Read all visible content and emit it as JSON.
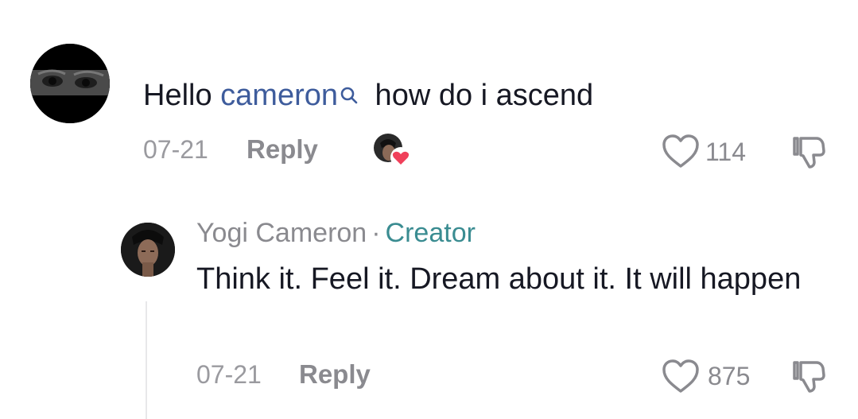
{
  "comment": {
    "prefix": "Hello ",
    "mention": "cameron",
    "suffix": " how do i ascend",
    "date": "07-21",
    "reply_label": "Reply",
    "like_count": "114"
  },
  "reply": {
    "author": "Yogi Cameron",
    "separator": "·",
    "badge": "Creator",
    "text": "Think it. Feel it. Dream about it. It will happen",
    "date": "07-21",
    "reply_label": "Reply",
    "like_count": "875"
  },
  "icons": {
    "search": "search-icon",
    "like": "heart-outline-icon",
    "dislike": "thumbs-down-icon",
    "creator_like": "heart-filled-icon"
  },
  "colors": {
    "mention": "#3e5c9c",
    "creator_badge": "#3a8c91",
    "creator_heart": "#f0405a",
    "muted": "#8a8a8f"
  }
}
